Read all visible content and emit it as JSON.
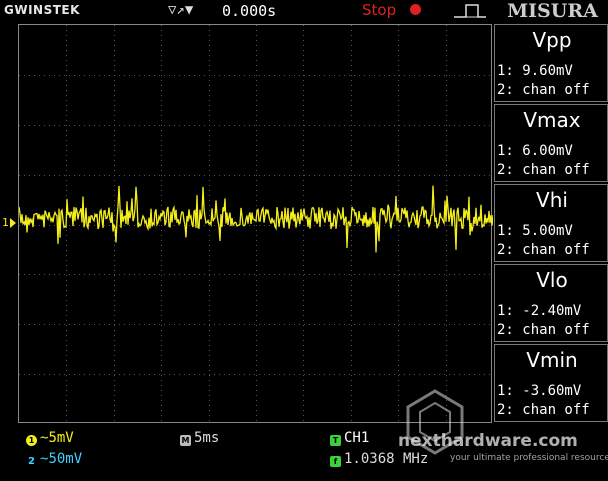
{
  "header": {
    "brand": "GWINSTEK",
    "trigger_icons": "▽↗▼",
    "trigger_position": "0.000s",
    "run_state": "Stop",
    "misura": "MISURA"
  },
  "channel1": {
    "ref_label": "1",
    "color": "#f4ee1a",
    "scale": "5mV",
    "coupling_symbol": "~"
  },
  "channel2": {
    "scale": "50mV",
    "coupling_symbol": "~",
    "color": "#3fd0ff"
  },
  "timebase": {
    "scale": "5ms"
  },
  "trigger": {
    "source": "CH1",
    "frequency": "1.0368 MHz"
  },
  "measurements": [
    {
      "name": "Vpp",
      "ch1": "1: 9.60mV",
      "ch2": "2: chan off"
    },
    {
      "name": "Vmax",
      "ch1": "1: 6.00mV",
      "ch2": "2: chan off"
    },
    {
      "name": "Vhi",
      "ch1": "1: 5.00mV",
      "ch2": "2: chan off"
    },
    {
      "name": "Vlo",
      "ch1": "1: -2.40mV",
      "ch2": "2: chan off"
    },
    {
      "name": "Vmin",
      "ch1": "1: -3.60mV",
      "ch2": "2: chan off"
    }
  ],
  "watermark": {
    "text": "nexthardware.com",
    "subtitle": "your ultimate professional resource"
  }
}
